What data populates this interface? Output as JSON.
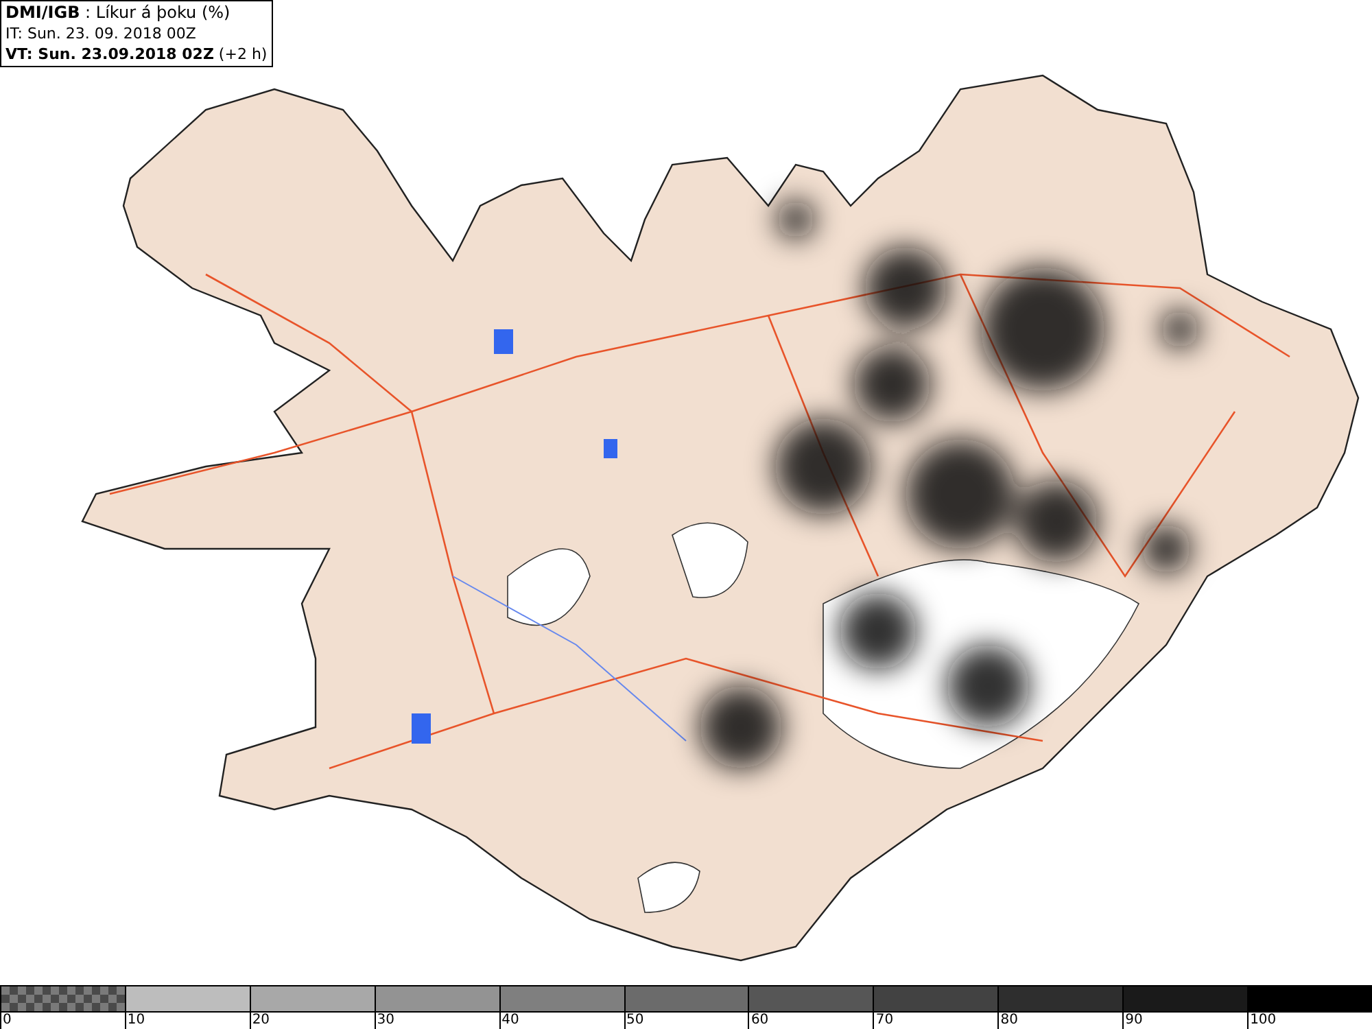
{
  "header": {
    "lines": [
      "**DMI/IGB** : Líkur á þoku (%)",
      "IT: Sun. 23. 09. 2018 00Z",
      "**VT: Sun. 23.09.2018 02Z** (+2 h)"
    ]
  },
  "legend": [
    {
      "label": "0",
      "kind": "checker",
      "color": "#7a7a7a"
    },
    {
      "label": "10",
      "kind": "solid",
      "color": "#bdbdbd"
    },
    {
      "label": "20",
      "kind": "solid",
      "color": "#a8a8a8"
    },
    {
      "label": "30",
      "kind": "solid",
      "color": "#939393"
    },
    {
      "label": "40",
      "kind": "solid",
      "color": "#7f7f7f"
    },
    {
      "label": "50",
      "kind": "solid",
      "color": "#6b6b6b"
    },
    {
      "label": "60",
      "kind": "solid",
      "color": "#565656"
    },
    {
      "label": "70",
      "kind": "solid",
      "color": "#424242"
    },
    {
      "label": "80",
      "kind": "solid",
      "color": "#2e2e2e"
    },
    {
      "label": "90",
      "kind": "solid",
      "color": "#1a1a1a"
    },
    {
      "label": "100",
      "kind": "solid",
      "color": "#000000"
    }
  ]
}
